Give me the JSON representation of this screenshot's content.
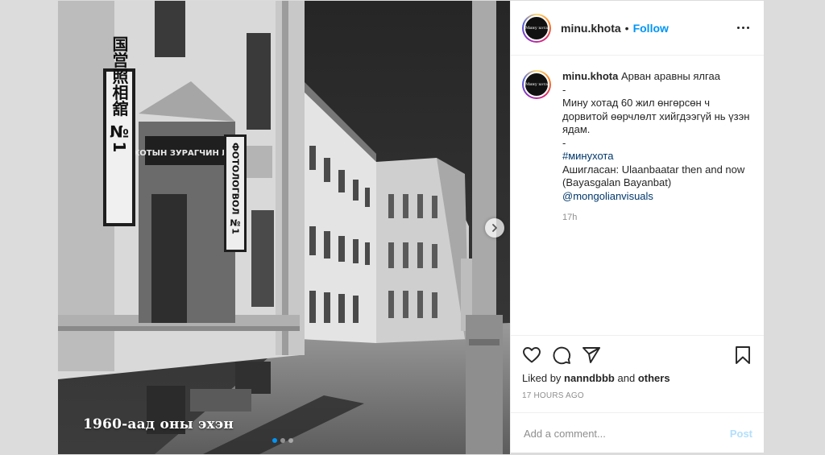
{
  "media": {
    "overlay_caption": "1960-аад оны эхэн",
    "sign_chinese": "国営照相舘 №1",
    "sign_mongolian": "ФОТОЛОГВОЛ №1",
    "sign_banner": "ХОТЫН ЗУРАГЧИН №1",
    "slide_count": 3,
    "active_slide": 1
  },
  "header": {
    "username": "minu.khota",
    "separator": "•",
    "follow_label": "Follow",
    "avatar_text": "Мину хота"
  },
  "caption": {
    "username": "minu.khota",
    "title": "Арван аравны ялгаа",
    "dash1": "-",
    "text": "Мину хотад 60 жил өнгөрсөн ч дорвитой өөрчлөлт хийгдээгүй нь үзэн ядам.",
    "dash2": "-",
    "hashtag": "#минухота",
    "credit": "Ашигласан: Ulaanbaatar then and now (Bayasgalan Bayanbat)",
    "mention": "@mongolianvisuals",
    "time": "17h"
  },
  "actions": {
    "liked_prefix": "Liked by",
    "liked_user": "nanndbbb",
    "liked_and": "and",
    "liked_others": "others",
    "time_ago": "17 HOURS AGO"
  },
  "comment_box": {
    "placeholder": "Add a comment...",
    "post_label": "Post"
  },
  "colors": {
    "accent": "#0095f6",
    "post_disabled": "#b2dffc",
    "secondary_text": "#8e8e8e",
    "link": "#00376b"
  },
  "icons": [
    "heart-icon",
    "comment-icon",
    "share-icon",
    "bookmark-icon",
    "more-icon",
    "chevron-right-icon"
  ]
}
